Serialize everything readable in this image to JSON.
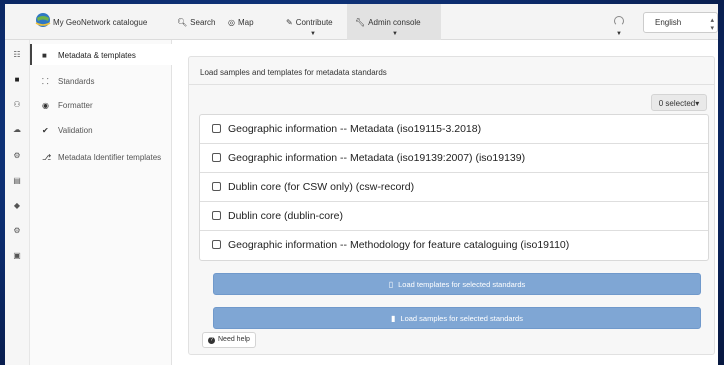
{
  "header": {
    "catalogue_name": "My GeoNetwork catalogue",
    "nav": [
      {
        "label": "Search",
        "icon": "search-icon"
      },
      {
        "label": "Map",
        "icon": "globe-icon"
      },
      {
        "label": "Contribute",
        "icon": "pencil-icon"
      },
      {
        "label": "Admin console",
        "icon": "wrench-icon"
      }
    ],
    "language": "English"
  },
  "rail": {
    "icons": [
      "grid-icon",
      "archive-icon",
      "users-icon",
      "cloud-icon",
      "cogs-icon",
      "file-icon",
      "tags-icon",
      "settings-icon",
      "database-icon"
    ]
  },
  "leftmenu": {
    "items": [
      {
        "label": "Metadata & templates",
        "icon": "archive-icon"
      },
      {
        "label": "Standards",
        "icon": "sitemap-icon"
      },
      {
        "label": "Formatter",
        "icon": "eye-icon"
      },
      {
        "label": "Validation",
        "icon": "check-icon"
      },
      {
        "label": "Metadata Identifier templates",
        "icon": "key-icon"
      }
    ]
  },
  "main": {
    "panel_title": "Load samples and templates for metadata standards",
    "selected_label": "0 selected",
    "standards": [
      "Geographic information -- Metadata (iso19115-3.2018)",
      "Geographic information -- Metadata (iso19139:2007) (iso19139)",
      "Dublin core (for CSW only) (csw-record)",
      "Dublin core (dublin-core)",
      "Geographic information -- Methodology for feature cataloguing (iso19110)"
    ],
    "load_templates_label": "Load templates for selected standards",
    "load_samples_label": "Load samples for selected standards",
    "help_label": "Need help"
  },
  "colors": {
    "primary_button": "#7fa6d4",
    "background_blue": "#0c2c6e"
  }
}
